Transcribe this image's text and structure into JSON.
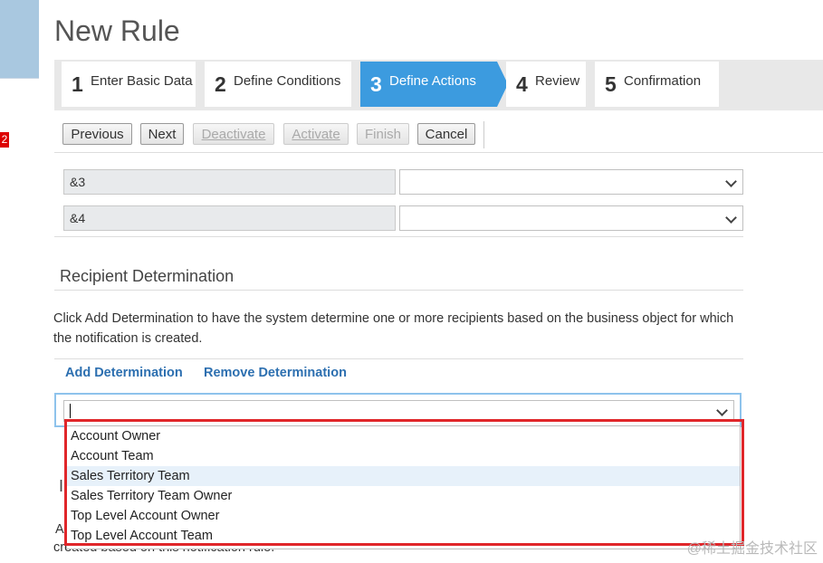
{
  "page": {
    "title": "New Rule",
    "edge_marker": "2"
  },
  "wizard": {
    "steps": [
      {
        "number": "1",
        "label": "Enter Basic Data"
      },
      {
        "number": "2",
        "label": "Define Conditions"
      },
      {
        "number": "3",
        "label": "Define Actions"
      },
      {
        "number": "4",
        "label": "Review"
      },
      {
        "number": "5",
        "label": "Confirmation"
      }
    ],
    "active_step": "3"
  },
  "toolbar": {
    "previous": "Previous",
    "next": "Next",
    "deactivate": "Deactivate",
    "activate": "Activate",
    "finish": "Finish",
    "cancel": "Cancel"
  },
  "placeholders": [
    {
      "label": "&3",
      "value": ""
    },
    {
      "label": "&4",
      "value": ""
    }
  ],
  "recipient": {
    "section_title": "Recipient Determination",
    "description": "Click Add Determination to have the system determine one or more recipients based on the business object for which the notification is created.",
    "add_link": "Add Determination",
    "remove_link": "Remove Determination",
    "combo_value": "",
    "options": [
      "Account Owner",
      "Account Team",
      "Sales Territory Team",
      "Sales Territory Team Owner",
      "Top Level Account Owner",
      "Top Level Account Team"
    ],
    "hovered_option": "Sales Territory Team"
  },
  "obscured": {
    "heading_fragment": "I",
    "line1_fragment": "A",
    "line2": "created based on this notification rule."
  },
  "watermark": "@稀土掘金技术社区",
  "colors": {
    "active_step": "#3c9bdf",
    "link": "#2c6fb0",
    "highlight_box": "#e0262a",
    "focus_border": "#8ec3ec"
  }
}
